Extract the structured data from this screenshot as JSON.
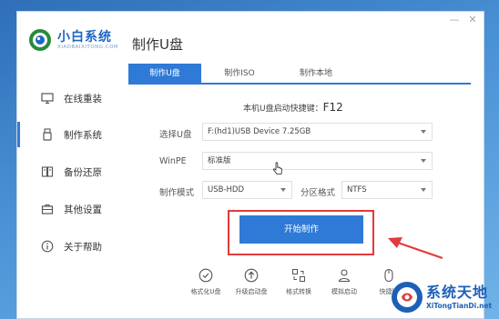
{
  "app": {
    "brand": "小白系统",
    "brand_sub": "XIAOBAIXITONG.COM",
    "page_title": "制作U盘",
    "minimize": "—",
    "close": "✕"
  },
  "sidebar": {
    "items": [
      {
        "label": "在线重装",
        "icon": "monitor-icon"
      },
      {
        "label": "制作系统",
        "icon": "usb-drive-icon"
      },
      {
        "label": "备份还原",
        "icon": "backup-icon"
      },
      {
        "label": "其他设置",
        "icon": "briefcase-icon"
      },
      {
        "label": "关于帮助",
        "icon": "info-icon"
      }
    ],
    "active_index": 1
  },
  "tabs": [
    {
      "label": "制作U盘",
      "active": true
    },
    {
      "label": "制作ISO",
      "active": false
    },
    {
      "label": "制作本地",
      "active": false
    }
  ],
  "hotkey": {
    "label": "本机U盘启动快捷键：",
    "key": "F12"
  },
  "form": {
    "usb_label": "选择U盘",
    "usb_value": "F:(hd1)USB Device 7.25GB",
    "winpe_label": "WinPE",
    "winpe_value": "标准版",
    "mode_label": "制作模式",
    "mode_value": "USB-HDD",
    "partition_label": "分区格式",
    "partition_value": "NTFS"
  },
  "start_button": "开始制作",
  "tools": [
    {
      "label": "格式化U盘",
      "icon": "check-circle-icon"
    },
    {
      "label": "升级启动盘",
      "icon": "upload-circle-icon"
    },
    {
      "label": "格式转换",
      "icon": "convert-icon"
    },
    {
      "label": "模拟启动",
      "icon": "user-icon"
    },
    {
      "label": "快捷键",
      "icon": "mouse-icon"
    }
  ],
  "watermark": {
    "title": "系统天地",
    "url": "XiTongTianDi.net"
  },
  "colors": {
    "accent": "#2f7ad6",
    "highlight": "#e23a3a",
    "brand": "#1f66c6"
  }
}
